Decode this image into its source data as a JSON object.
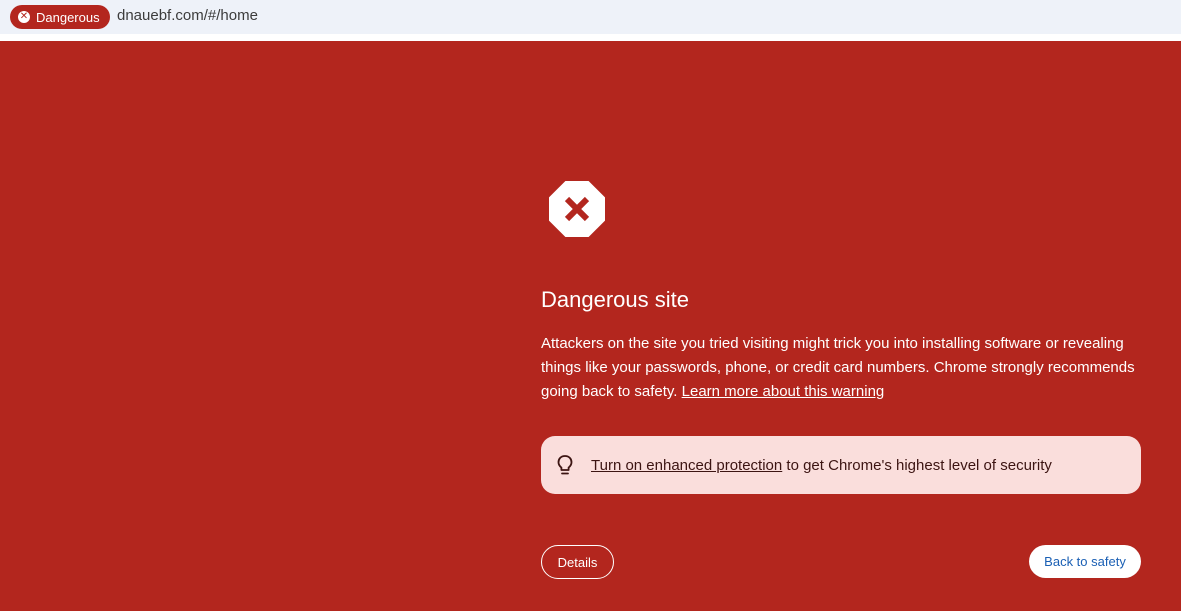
{
  "address_bar": {
    "security_chip_label": "Dangerous",
    "security_chip_icon": "error-circle-icon",
    "url": "dnauebf.com/#/home"
  },
  "interstitial": {
    "icon": "stop-octagon-icon",
    "title": "Dangerous site",
    "message": "Attackers on the site you tried visiting might trick you into installing software or revealing things like your passwords, phone, or credit card numbers. Chrome strongly recommends going back to safety. ",
    "learn_more_link": "Learn more about this warning",
    "protection_box": {
      "icon": "lightbulb-icon",
      "link_text": "Turn on enhanced protection",
      "suffix_text": " to get Chrome's highest level of security"
    },
    "details_button": "Details",
    "back_button": "Back to safety"
  },
  "colors": {
    "background": "#b3261e",
    "address_bar_bg": "#eef2f9",
    "protection_box_bg": "#fadedc",
    "back_button_text": "#1a5fb4"
  }
}
